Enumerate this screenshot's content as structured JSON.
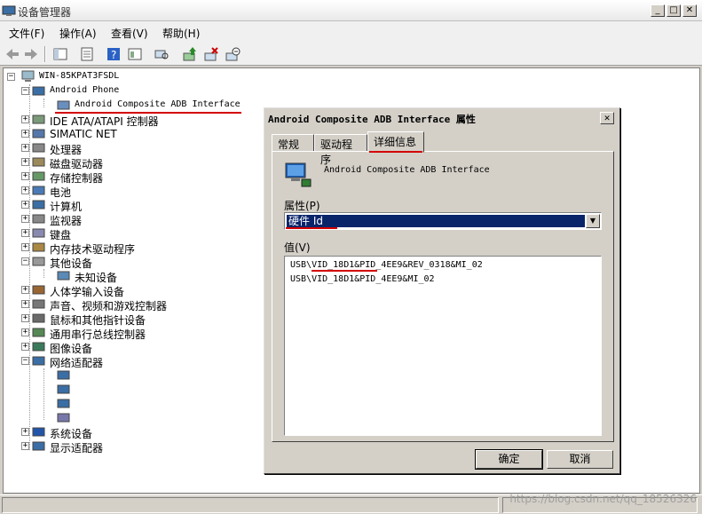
{
  "window": {
    "title": "设备管理器"
  },
  "menu": [
    "文件(F)",
    "操作(A)",
    "查看(V)",
    "帮助(H)"
  ],
  "tree": {
    "root": "WIN-85KPAT3FSDL",
    "nodes": [
      {
        "label": "Android Phone",
        "mono": true,
        "expanded": true
      },
      {
        "label": "Android Composite ADB Interface",
        "mono": true,
        "child": true
      },
      {
        "label": "IDE ATA/ATAPI 控制器"
      },
      {
        "label": "SIMATIC NET"
      },
      {
        "label": "处理器"
      },
      {
        "label": "磁盘驱动器"
      },
      {
        "label": "存储控制器"
      },
      {
        "label": "电池"
      },
      {
        "label": "计算机"
      },
      {
        "label": "监视器"
      },
      {
        "label": "键盘"
      },
      {
        "label": "内存技术驱动程序"
      },
      {
        "label": "其他设备",
        "expanded": true
      },
      {
        "label": "未知设备",
        "child": true
      },
      {
        "label": "人体学输入设备"
      },
      {
        "label": "声音、视频和游戏控制器"
      },
      {
        "label": "鼠标和其他指针设备"
      },
      {
        "label": "通用串行总线控制器"
      },
      {
        "label": "图像设备"
      },
      {
        "label": "网络适配器",
        "expanded": true
      },
      {
        "label": "",
        "child": true
      },
      {
        "label": "",
        "child": true
      },
      {
        "label": "",
        "child": true
      },
      {
        "label": "",
        "child": true
      },
      {
        "label": "系统设备"
      },
      {
        "label": "显示适配器"
      }
    ]
  },
  "dialog": {
    "title": "Android Composite ADB Interface 属性",
    "close": "✕",
    "tabs": [
      "常规",
      "驱动程序",
      "详细信息"
    ],
    "active_tab": "详细信息",
    "device_name": "Android Composite ADB Interface",
    "property_label": "属性(P)",
    "property_selected": "硬件 Id",
    "value_label": "值(V)",
    "values": [
      "USB\\VID_18D1&PID_4EE9&REV_0318&MI_02",
      "USB\\VID_18D1&PID_4EE9&MI_02"
    ],
    "ok": "确定",
    "cancel": "取消"
  },
  "watermark": "https://blog.csdn.net/qq_18526326",
  "colors": {
    "selection": "#0a246a",
    "annotation": "#d40000"
  }
}
